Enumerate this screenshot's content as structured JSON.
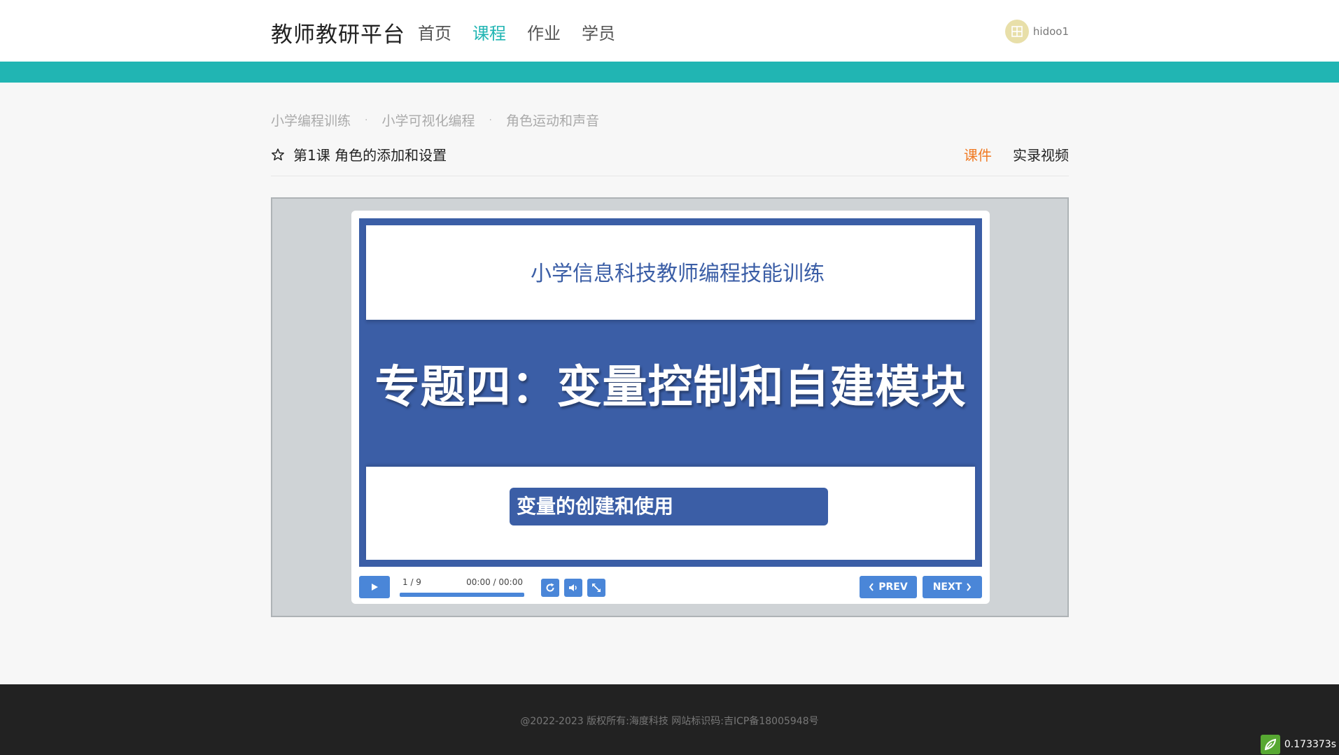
{
  "header": {
    "brand": "教师教研平台",
    "nav": [
      {
        "label": "首页",
        "active": false
      },
      {
        "label": "课程",
        "active": true
      },
      {
        "label": "作业",
        "active": false
      },
      {
        "label": "学员",
        "active": false
      }
    ],
    "user": {
      "name": "hidoo1",
      "avatar_icon": "user-avatar-icon"
    }
  },
  "breadcrumb": [
    "小学编程训练",
    "小学可视化编程",
    "角色运动和声音"
  ],
  "lesson": {
    "title": "第1课 角色的添加和设置",
    "tabs": [
      {
        "label": "课件",
        "active": true
      },
      {
        "label": "实录视频",
        "active": false
      }
    ]
  },
  "slide": {
    "subtitle": "小学信息科技教师编程技能训练",
    "title": "专题四：变量控制和自建模块",
    "tag": "变量的创建和使用"
  },
  "player": {
    "slide_counter": "1 / 9",
    "time": "00:00 / 00:00",
    "progress": 0,
    "prev_label": "PREV",
    "next_label": "NEXT"
  },
  "footer": {
    "copyright": "@2022-2023 版权所有:海度科技 网站标识码:吉ICP备18005948号"
  },
  "debug": {
    "timer": "0.173373s"
  },
  "colors": {
    "accent": "#21b5b3",
    "active_tab": "#f07b25",
    "slide_blue": "#3b5ea6",
    "player_button": "#4a86d8",
    "footer_bg": "#222222"
  }
}
